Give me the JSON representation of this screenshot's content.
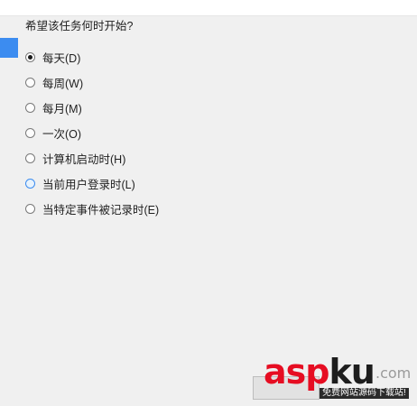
{
  "question": "希望该任务何时开始?",
  "options": [
    {
      "label": "每天(D)",
      "checked": true
    },
    {
      "label": "每周(W)",
      "checked": false
    },
    {
      "label": "每月(M)",
      "checked": false
    },
    {
      "label": "一次(O)",
      "checked": false
    },
    {
      "label": "计算机启动时(H)",
      "checked": false
    },
    {
      "label": "当前用户登录时(L)",
      "checked": false
    },
    {
      "label": "当特定事件被记录时(E)",
      "checked": false
    }
  ],
  "watermark": {
    "part1": "asp",
    "part2": "ku",
    "suffix": ".com",
    "tagline": "免费网站源码下载站!"
  },
  "colors": {
    "accent": "#3c8cf0",
    "background": "#f0f0f0",
    "watermark_red": "#e60d22"
  }
}
